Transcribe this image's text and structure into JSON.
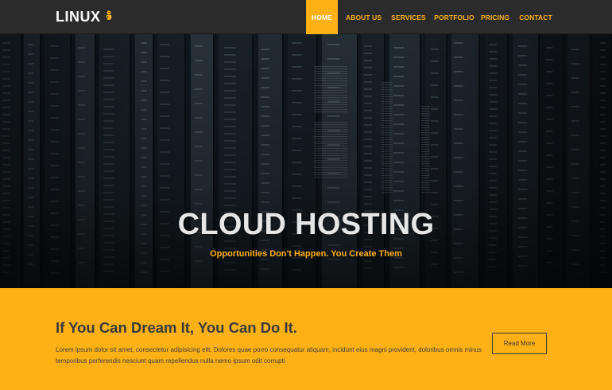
{
  "brand": {
    "logo_text": "LINUX",
    "logo_icon": "penguin-icon"
  },
  "nav": {
    "items": [
      {
        "label": "HOME",
        "active": true
      },
      {
        "label": "ABOUT US",
        "active": false
      },
      {
        "label": "SERVICES",
        "active": false
      },
      {
        "label": "PORTFOLIO",
        "active": false
      },
      {
        "label": "PRICING",
        "active": false
      },
      {
        "label": "CONTACT",
        "active": false
      }
    ]
  },
  "hero": {
    "title": "CLOUD HOSTING",
    "subtitle": "Opportunities Don't Happen. You Create Them"
  },
  "cta": {
    "heading": "If You Can Dream It, You Can Do It.",
    "text": "Lorem ipsum dolor sit amet, consectetur adipisicing elit. Dolores quae porro consequatur aliquam, incidunt eius magni provident, doloribus omnis minus temporibus perferendis nesciunt quam repellendus nulla nemo ipsum odit corrupti",
    "button_label": "Read More"
  },
  "colors": {
    "accent": "#fdb114",
    "navbar_bg": "#2b2b2b",
    "hero_bg": "#0e151c",
    "text_dark": "#3a3a3a"
  }
}
